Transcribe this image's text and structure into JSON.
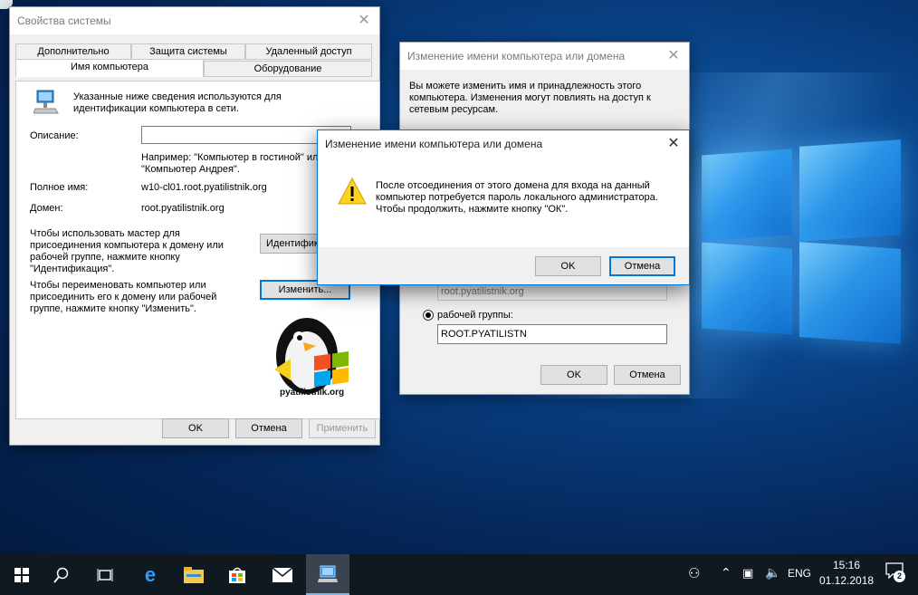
{
  "sysprops": {
    "title": "Свойства системы",
    "tabs": [
      "Дополнительно",
      "Защита системы",
      "Удаленный доступ",
      "Имя компьютера",
      "Оборудование"
    ],
    "intro": "Указанные ниже сведения используются для идентификации компьютера в сети.",
    "description_label": "Описание:",
    "description_value": "",
    "example_text": "Например: \"Компьютер в гостиной\" или \"Компьютер Андрея\".",
    "fullname_label": "Полное имя:",
    "fullname_value": "w10-cl01.root.pyatilistnik.org",
    "domain_label": "Домен:",
    "domain_value": "root.pyatilistnik.org",
    "wizard_text": "Чтобы использовать мастер для присоединения компьютера к домену или рабочей группе, нажмите кнопку \"Идентификация\".",
    "identify_button": "Идентификация...",
    "rename_text": "Чтобы переименовать компьютер или присоединить его к домену или рабочей группе, нажмите кнопку \"Изменить\".",
    "change_button": "Изменить...",
    "watermark": "pyatilistnik.org",
    "ok": "OK",
    "cancel": "Отмена",
    "apply": "Применить"
  },
  "rename_dialog": {
    "title": "Изменение имени компьютера или домена",
    "intro": "Вы можете изменить имя и принадлежность этого компьютера. Изменения могут повлиять на доступ к сетевым ресурсам.",
    "domain_value": "root.pyatilistnik.org",
    "workgroup_label": "рабочей группы:",
    "workgroup_value": "ROOT.PYATILISTN",
    "ok": "OK",
    "cancel": "Отмена"
  },
  "confirm_dialog": {
    "title": "Изменение имени компьютера или домена",
    "message": "После отсоединения от этого домена для входа на данный компьютер потребуется пароль локального администратора. Чтобы продолжить, нажмите кнопку \"ОК\".",
    "ok": "OK",
    "cancel": "Отмена"
  },
  "taskbar": {
    "lang": "ENG",
    "time": "15:16",
    "date": "01.12.2018",
    "notifications": "2",
    "icons": [
      "windows-start-icon",
      "search-icon",
      "task-view-icon",
      "edge-icon",
      "file-explorer-icon",
      "store-icon",
      "mail-icon",
      "system-properties-icon"
    ]
  },
  "colors": {
    "accent": "#0078d7",
    "taskbar": "#101820",
    "desktop": "#073a7a"
  }
}
